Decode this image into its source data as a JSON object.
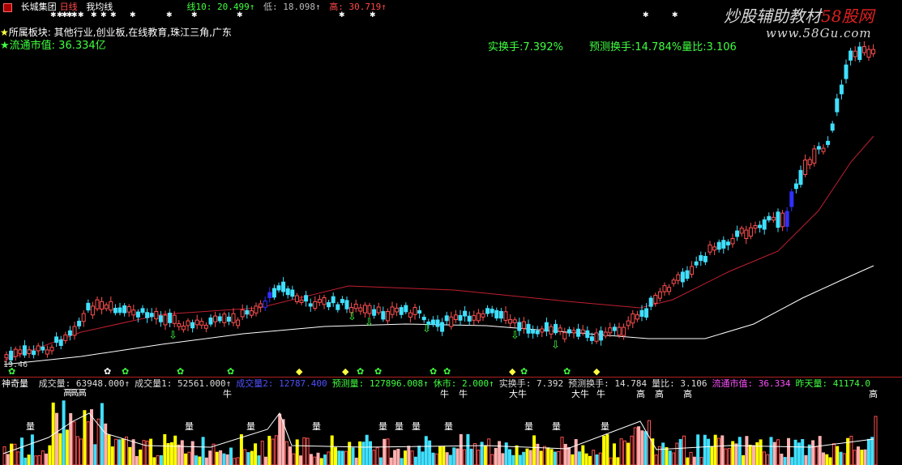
{
  "header": {
    "stock_name": "长城集团",
    "period": "日线",
    "indicator": "我均线",
    "ma_label": "线10: 20.499↑",
    "low_label": "低: 18.098↑",
    "high_label": "高: 30.719↑"
  },
  "info": {
    "sector_label": "所属板块: 其他行业,创业板,在线教育,珠江三角,广东",
    "market_cap_label": "流通市值: 36.334亿",
    "turnover_label": "实换手:7.392%",
    "predicted_turnover_label": "预测换手:14.784%量比:3.106",
    "price_label": "19.46"
  },
  "watermark": {
    "line1": "炒股辅助教材",
    "line1_accent": "58股网",
    "line2": "www.58Gu.com"
  },
  "volume_bar": {
    "indicator": "神奇量",
    "items": [
      {
        "text": "成交量: 63948.000↑",
        "color": "#dddddd"
      },
      {
        "text": "成交量1: 52561.000↑",
        "color": "#dddddd"
      },
      {
        "text": "成交量2: 12787.400",
        "color": "#5050ff"
      },
      {
        "text": "预测量: 127896.008↑",
        "color": "#40ff40"
      },
      {
        "text": "休市: 2.000↑",
        "color": "#40ff40"
      },
      {
        "text": "实换手: 7.392",
        "color": "#dddddd"
      },
      {
        "text": "预测换手: 14.784",
        "color": "#dddddd"
      },
      {
        "text": "量比: 3.106",
        "color": "#dddddd"
      },
      {
        "text": "流通市值: 36.334",
        "color": "#ff50ff"
      },
      {
        "text": "昨天量: 41174.0",
        "color": "#40ff40"
      }
    ]
  },
  "signals": {
    "high": "高",
    "bull": "牛",
    "big_bull": "大牛",
    "quantity": "量"
  },
  "colors": {
    "up_candle": "#ff5050",
    "down_candle": "#40e0ff",
    "ma_long": "#ffffff",
    "ma_mid": "#c02030",
    "vol_yellow": "#ffff00"
  }
}
